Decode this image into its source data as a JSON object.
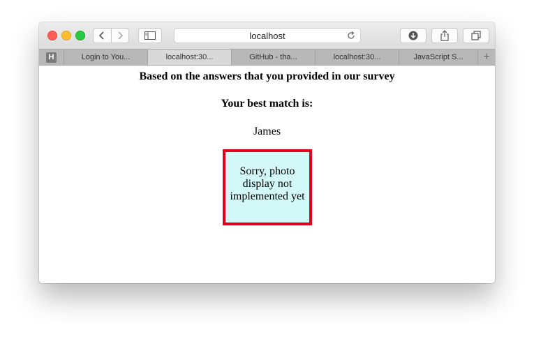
{
  "browser": {
    "address": "localhost",
    "pinned_tab_letter": "H",
    "tabs": [
      {
        "label": "Login to You..."
      },
      {
        "label": "localhost:30..."
      },
      {
        "label": "GitHub - tha..."
      },
      {
        "label": "localhost:30..."
      },
      {
        "label": "JavaScript S..."
      }
    ],
    "new_tab": "+"
  },
  "page": {
    "line1": "Based on the answers that you provided in our survey",
    "line2": "Your best match is:",
    "match_name": "James",
    "photo_placeholder": "Sorry, photo display not implemented yet"
  },
  "colors": {
    "photo_border": "#e2001b",
    "photo_background": "#d3f8f8",
    "close": "#fd5c57",
    "minimize": "#fdbb2e",
    "maximize": "#29c940"
  },
  "icons": [
    "back-icon",
    "forward-icon",
    "sidebar-icon",
    "reload-icon",
    "download-icon",
    "share-icon",
    "tabs-overview-icon"
  ]
}
